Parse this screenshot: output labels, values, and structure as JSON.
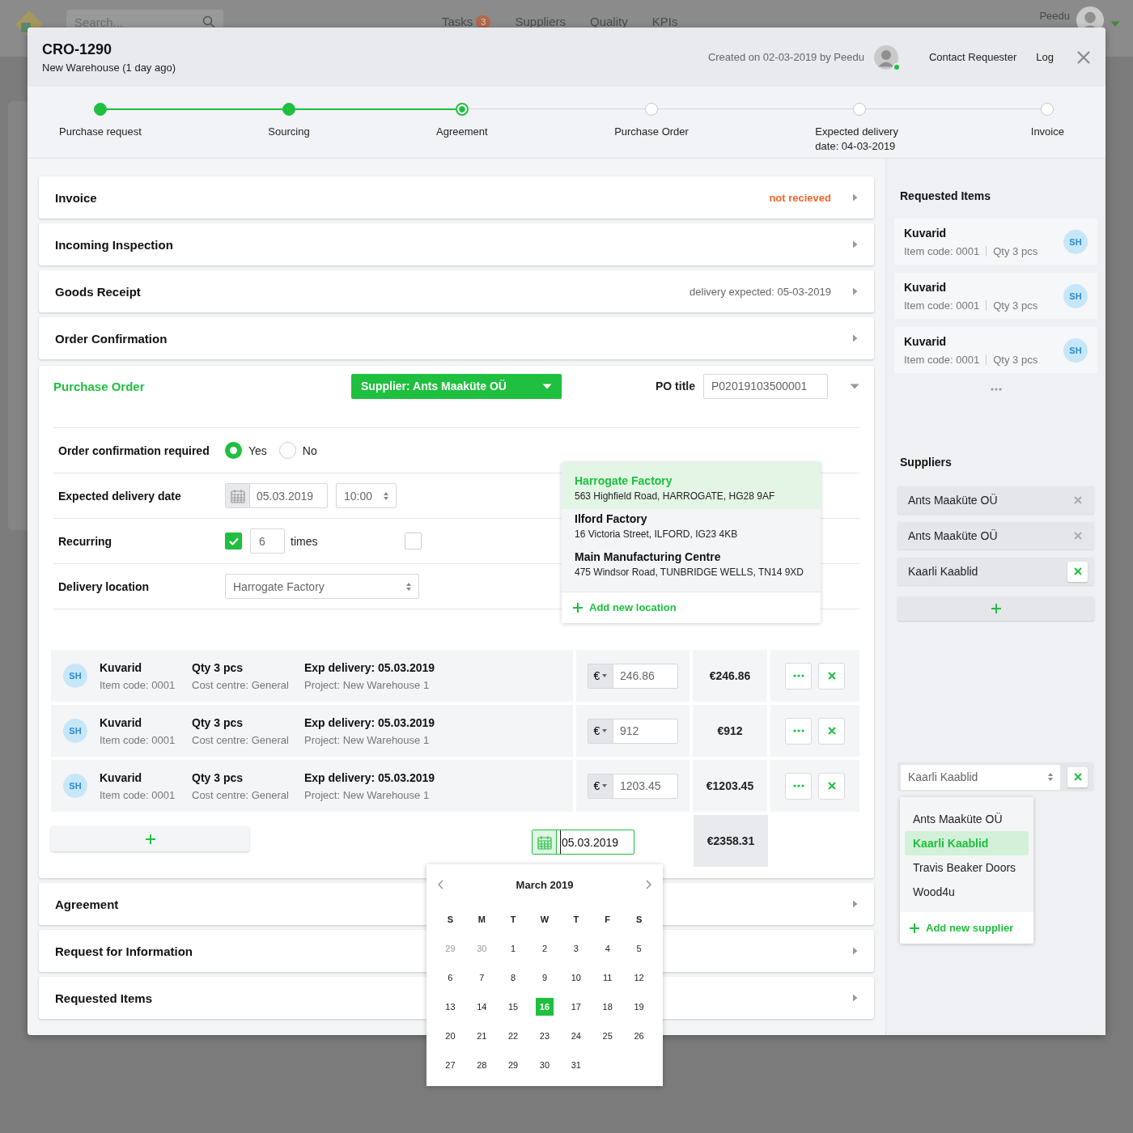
{
  "backdrop": {
    "search_placeholder": "Search...",
    "nav": [
      {
        "label": "Tasks",
        "badge": "3"
      },
      {
        "label": "Suppliers"
      },
      {
        "label": "Quality"
      },
      {
        "label": "KPIs"
      }
    ],
    "user": "Peedu"
  },
  "header": {
    "code": "CRO-1290",
    "subtitle": "New Warehouse (1 day ago)",
    "created": "Created on 02-03-2019 by Peedu",
    "requester_online": true,
    "links": [
      "Contact Requester",
      "Log"
    ]
  },
  "steps": [
    {
      "label": "Purchase request",
      "done": true,
      "current": false
    },
    {
      "label": "Sourcing",
      "done": true,
      "current": false
    },
    {
      "label": "Agreement",
      "done": false,
      "current": true
    },
    {
      "label": "Purchase Order",
      "done": false,
      "current": false
    },
    {
      "label": "Expected delivery date: 04-03-2019",
      "done": false,
      "current": false
    },
    {
      "label": "Invoice",
      "done": false,
      "current": false
    }
  ],
  "sections_top": [
    {
      "title": "Invoice",
      "note": "not recieved",
      "alert": true
    },
    {
      "title": "Incoming Inspection"
    },
    {
      "title": "Goods Receipt",
      "note": "delivery expected: 05-03-2019",
      "alert": false
    },
    {
      "title": "Order Confirmation"
    }
  ],
  "purchase_order": {
    "title": "Purchase Order",
    "expanded": true,
    "supplier": "Supplier: Ants Maaküte OÜ",
    "po_title_label": "PO title",
    "po_title": "P02019103500001",
    "fields": [
      {
        "kind": "radio",
        "label": "Order confirmation required",
        "options": [
          {
            "label": "Yes",
            "selected": true
          },
          {
            "label": "No",
            "selected": false
          }
        ]
      },
      {
        "kind": "datetime",
        "label": "Expected delivery date",
        "date": "05.03.2019",
        "time": "10:00"
      },
      {
        "kind": "recurring",
        "label": "Recurring",
        "checked": true,
        "count": "6",
        "unit": "times",
        "extra_checked": false
      },
      {
        "kind": "select",
        "label": "Delivery location",
        "value": "Harrogate Factory"
      }
    ],
    "location_menu": {
      "options": [
        {
          "name": "Harrogate Factory",
          "address": "563 Highfield Road, HARROGATE, HG28 9AF",
          "selected": true
        },
        {
          "name": "Ilford Factory",
          "address": "16 Victoria Street, ILFORD, IG23 4KB",
          "selected": false
        },
        {
          "name": "Main Manufacturing Centre",
          "address": "475 Windsor Road, TUNBRIDGE WELLS, TN14 9XD",
          "selected": false
        }
      ],
      "add_label": "Add new location"
    },
    "lines": [
      {
        "avatar": "SH",
        "name": "Kuvarid",
        "code": "Item code: 0001",
        "qty": "Qty 3 pcs",
        "cost_centre": "Cost centre: General",
        "delivery": "Exp delivery: 05.03.2019",
        "project": "Project: New Warehouse 1",
        "currency": "€",
        "price": "246.86",
        "total": "€246.86"
      },
      {
        "avatar": "SH",
        "name": "Kuvarid",
        "code": "Item code: 0001",
        "qty": "Qty 3 pcs",
        "cost_centre": "Cost centre: General",
        "delivery": "Exp delivery: 05.03.2019",
        "project": "Project: New Warehouse 1",
        "currency": "€",
        "price": "912",
        "total": "€912"
      },
      {
        "avatar": "SH",
        "name": "Kuvarid",
        "code": "Item code: 0001",
        "qty": "Qty 3 pcs",
        "cost_centre": "Cost centre: General",
        "delivery": "Exp delivery: 05.03.2019",
        "project": "Project: New Warehouse 1",
        "currency": "€",
        "price": "1203.45",
        "total": "€1203.45"
      }
    ],
    "date_value": "05.03.2019",
    "grand_total": "€2358.31",
    "calendar": {
      "month": "March 2019",
      "weekdays": [
        "S",
        "M",
        "T",
        "W",
        "T",
        "F",
        "S"
      ],
      "weeks": [
        [
          {
            "day": "29",
            "muted": true,
            "selected": false
          },
          {
            "day": "30",
            "muted": true,
            "selected": false
          },
          {
            "day": "1",
            "muted": false,
            "selected": false
          },
          {
            "day": "2",
            "muted": false,
            "selected": false
          },
          {
            "day": "3",
            "muted": false,
            "selected": false
          },
          {
            "day": "4",
            "muted": false,
            "selected": false
          },
          {
            "day": "5",
            "muted": false,
            "selected": false
          }
        ],
        [
          {
            "day": "6",
            "muted": false,
            "selected": false
          },
          {
            "day": "7",
            "muted": false,
            "selected": false
          },
          {
            "day": "8",
            "muted": false,
            "selected": false
          },
          {
            "day": "9",
            "muted": false,
            "selected": false
          },
          {
            "day": "10",
            "muted": false,
            "selected": false
          },
          {
            "day": "11",
            "muted": false,
            "selected": false
          },
          {
            "day": "12",
            "muted": false,
            "selected": false
          }
        ],
        [
          {
            "day": "13",
            "muted": false,
            "selected": false
          },
          {
            "day": "14",
            "muted": false,
            "selected": false
          },
          {
            "day": "15",
            "muted": false,
            "selected": false
          },
          {
            "day": "16",
            "muted": false,
            "selected": true
          },
          {
            "day": "17",
            "muted": false,
            "selected": false
          },
          {
            "day": "18",
            "muted": false,
            "selected": false
          },
          {
            "day": "19",
            "muted": false,
            "selected": false
          }
        ],
        [
          {
            "day": "20",
            "muted": false,
            "selected": false
          },
          {
            "day": "21",
            "muted": false,
            "selected": false
          },
          {
            "day": "22",
            "muted": false,
            "selected": false
          },
          {
            "day": "23",
            "muted": false,
            "selected": false
          },
          {
            "day": "24",
            "muted": false,
            "selected": false
          },
          {
            "day": "25",
            "muted": false,
            "selected": false
          },
          {
            "day": "26",
            "muted": false,
            "selected": false
          }
        ],
        [
          {
            "day": "27",
            "muted": false,
            "selected": false
          },
          {
            "day": "28",
            "muted": false,
            "selected": false
          },
          {
            "day": "29",
            "muted": false,
            "selected": false
          },
          {
            "day": "30",
            "muted": false,
            "selected": false
          },
          {
            "day": "31",
            "muted": false,
            "selected": false
          }
        ]
      ]
    }
  },
  "sections_bottom": [
    {
      "title": "Agreement"
    },
    {
      "title": "Request for Information"
    },
    {
      "title": "Requested Items"
    }
  ],
  "sidebar": {
    "items_title": "Requested Items",
    "items": [
      {
        "name": "Kuvarid",
        "code": "Item code: 0001",
        "qty": "Qty 3 pcs",
        "avatar": "SH"
      },
      {
        "name": "Kuvarid",
        "code": "Item code: 0001",
        "qty": "Qty 3 pcs",
        "avatar": "SH"
      },
      {
        "name": "Kuvarid",
        "code": "Item code: 0001",
        "qty": "Qty 3 pcs",
        "avatar": "SH"
      }
    ],
    "suppliers_title": "Suppliers",
    "suppliers": [
      {
        "name": "Ants Maaküte OÜ",
        "selected": false
      },
      {
        "name": "Ants Maaküte OÜ",
        "selected": false
      },
      {
        "name": "Kaarli Kaablid",
        "selected": true
      }
    ],
    "supplier_select": "Kaarli Kaablid",
    "supplier_options": [
      {
        "name": "Ants Maaküte OÜ",
        "selected": false
      },
      {
        "name": "Kaarli Kaablid",
        "selected": true
      },
      {
        "name": "Travis Beaker Doors",
        "selected": false
      },
      {
        "name": "Wood4u",
        "selected": false
      }
    ],
    "add_supplier": "Add new supplier"
  }
}
